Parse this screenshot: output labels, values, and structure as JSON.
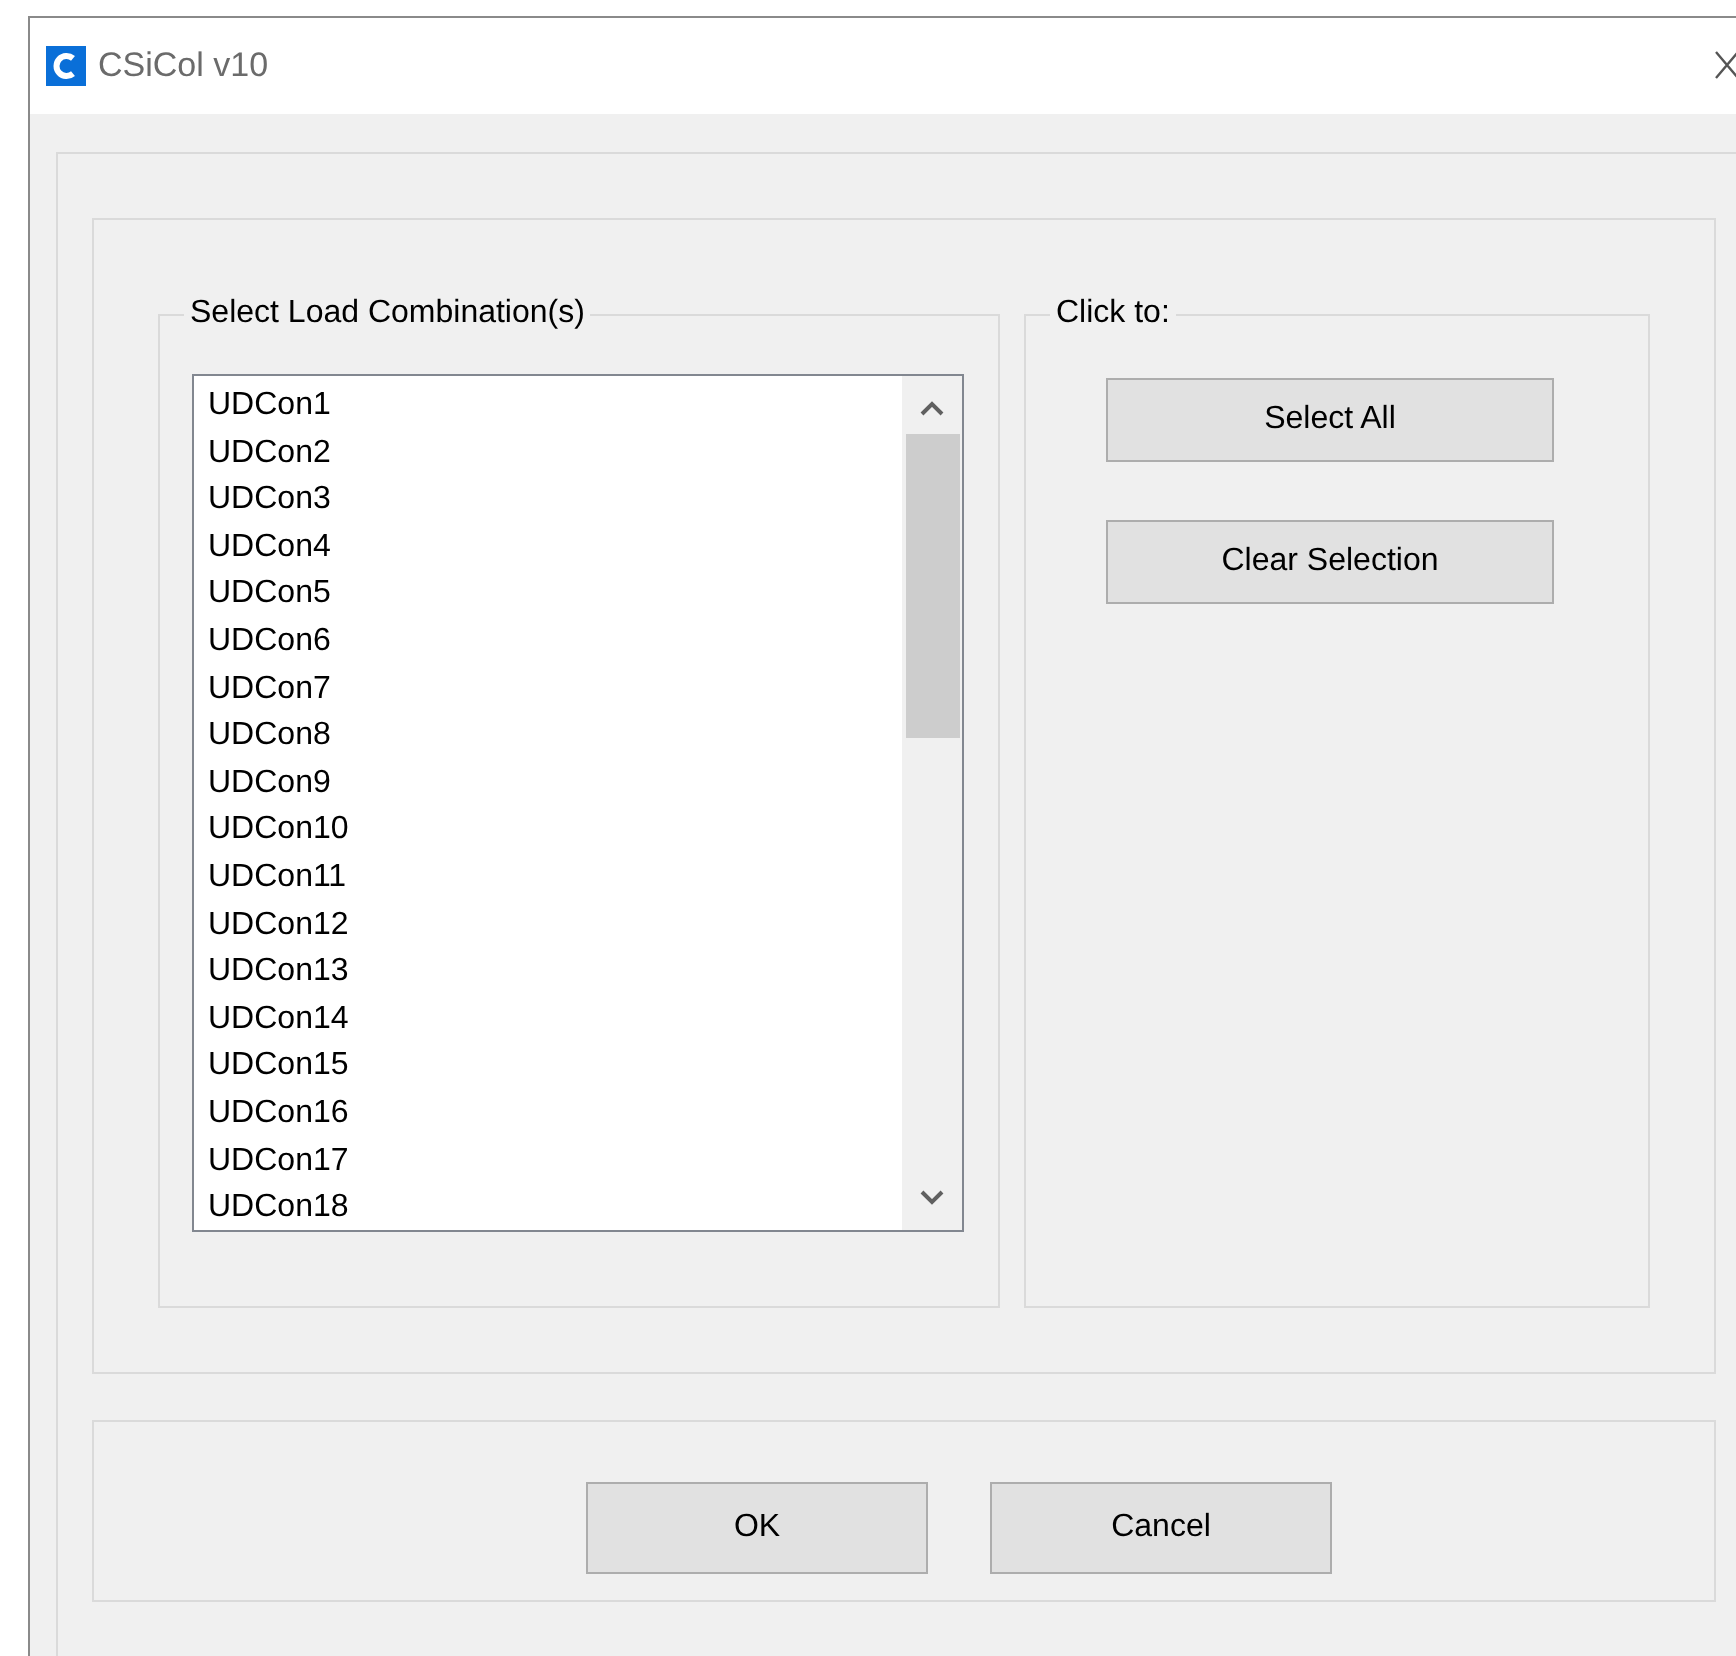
{
  "window": {
    "title": "CSiCol v10"
  },
  "load_group": {
    "title": "Select Load Combination(s)",
    "items": [
      "UDCon1",
      "UDCon2",
      "UDCon3",
      "UDCon4",
      "UDCon5",
      "UDCon6",
      "UDCon7",
      "UDCon8",
      "UDCon9",
      "UDCon10",
      "UDCon11",
      "UDCon12",
      "UDCon13",
      "UDCon14",
      "UDCon15",
      "UDCon16",
      "UDCon17",
      "UDCon18"
    ]
  },
  "click_group": {
    "title": "Click to:",
    "buttons": [
      "Select All",
      "Clear Selection"
    ]
  },
  "buttons": [
    "OK",
    "Cancel"
  ]
}
